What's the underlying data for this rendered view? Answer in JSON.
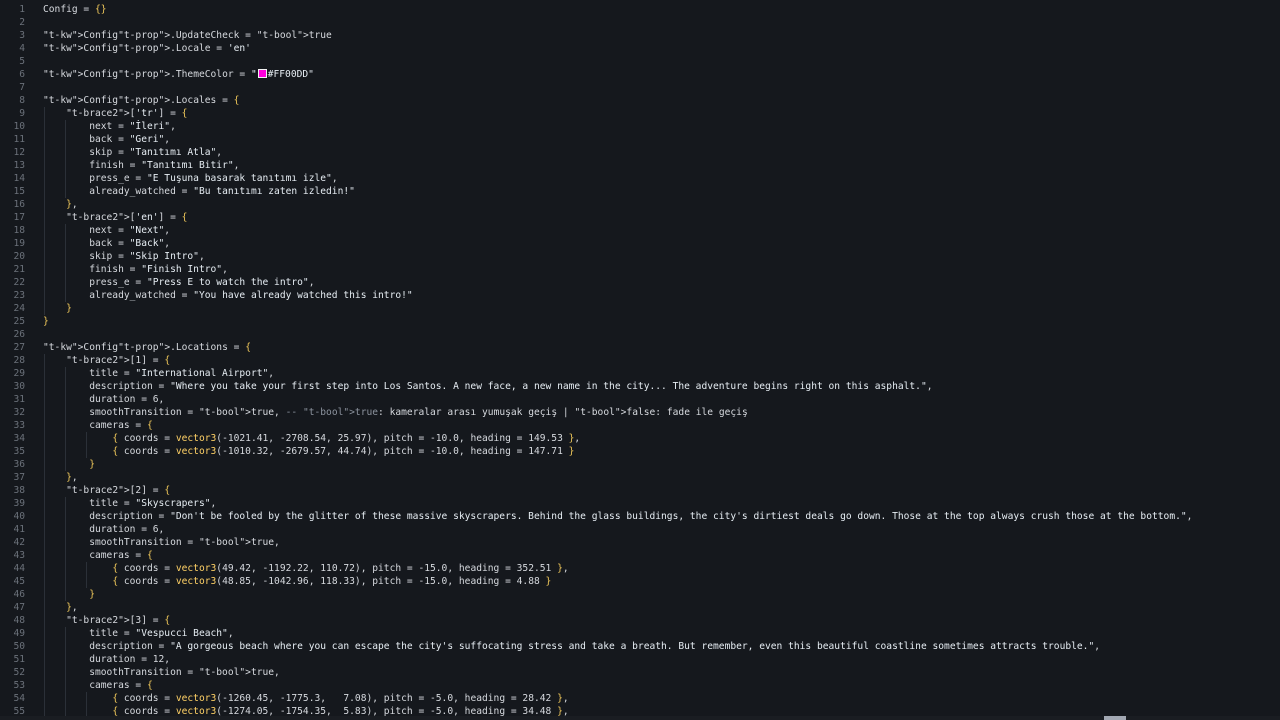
{
  "editor": {
    "lines": [
      {
        "n": "1",
        "text": "Config = {}"
      },
      {
        "n": "2",
        "text": ""
      },
      {
        "n": "3",
        "text": "Config.UpdateCheck = true"
      },
      {
        "n": "4",
        "text": "Config.Locale = 'en'"
      },
      {
        "n": "5",
        "text": ""
      },
      {
        "n": "6",
        "text": "Config.ThemeColor = \"#FF00DD\""
      },
      {
        "n": "7",
        "text": ""
      },
      {
        "n": "8",
        "text": "Config.Locales = {"
      },
      {
        "n": "9",
        "text": "    ['tr'] = {"
      },
      {
        "n": "10",
        "text": "        next = \"İleri\","
      },
      {
        "n": "11",
        "text": "        back = \"Geri\","
      },
      {
        "n": "12",
        "text": "        skip = \"Tanıtımı Atla\","
      },
      {
        "n": "13",
        "text": "        finish = \"Tanıtımı Bitir\","
      },
      {
        "n": "14",
        "text": "        press_e = \"E Tuşuna basarak tanıtımı izle\","
      },
      {
        "n": "15",
        "text": "        already_watched = \"Bu tanıtımı zaten izledin!\""
      },
      {
        "n": "16",
        "text": "    },"
      },
      {
        "n": "17",
        "text": "    ['en'] = {"
      },
      {
        "n": "18",
        "text": "        next = \"Next\","
      },
      {
        "n": "19",
        "text": "        back = \"Back\","
      },
      {
        "n": "20",
        "text": "        skip = \"Skip Intro\","
      },
      {
        "n": "21",
        "text": "        finish = \"Finish Intro\","
      },
      {
        "n": "22",
        "text": "        press_e = \"Press E to watch the intro\","
      },
      {
        "n": "23",
        "text": "        already_watched = \"You have already watched this intro!\""
      },
      {
        "n": "24",
        "text": "    }"
      },
      {
        "n": "25",
        "text": "}"
      },
      {
        "n": "26",
        "text": ""
      },
      {
        "n": "27",
        "text": "Config.Locations = {"
      },
      {
        "n": "28",
        "text": "    [1] = {"
      },
      {
        "n": "29",
        "text": "        title = \"International Airport\","
      },
      {
        "n": "30",
        "text": "        description = \"Where you take your first step into Los Santos. A new face, a new name in the city... The adventure begins right on this asphalt.\","
      },
      {
        "n": "31",
        "text": "        duration = 6,"
      },
      {
        "n": "32",
        "text": "        smoothTransition = true, -- true: kameralar arası yumuşak geçiş | false: fade ile geçiş"
      },
      {
        "n": "33",
        "text": "        cameras = {"
      },
      {
        "n": "34",
        "text": "            { coords = vector3(-1021.41, -2708.54, 25.97), pitch = -10.0, heading = 149.53 },"
      },
      {
        "n": "35",
        "text": "            { coords = vector3(-1010.32, -2679.57, 44.74), pitch = -10.0, heading = 147.71 }"
      },
      {
        "n": "36",
        "text": "        }"
      },
      {
        "n": "37",
        "text": "    },"
      },
      {
        "n": "38",
        "text": "    [2] = {"
      },
      {
        "n": "39",
        "text": "        title = \"Skyscrapers\","
      },
      {
        "n": "40",
        "text": "        description = \"Don't be fooled by the glitter of these massive skyscrapers. Behind the glass buildings, the city's dirtiest deals go down. Those at the top always crush those at the bottom.\","
      },
      {
        "n": "41",
        "text": "        duration = 6,"
      },
      {
        "n": "42",
        "text": "        smoothTransition = true,"
      },
      {
        "n": "43",
        "text": "        cameras = {"
      },
      {
        "n": "44",
        "text": "            { coords = vector3(49.42, -1192.22, 110.72), pitch = -15.0, heading = 352.51 },"
      },
      {
        "n": "45",
        "text": "            { coords = vector3(48.85, -1042.96, 118.33), pitch = -15.0, heading = 4.88 }"
      },
      {
        "n": "46",
        "text": "        }"
      },
      {
        "n": "47",
        "text": "    },"
      },
      {
        "n": "48",
        "text": "    [3] = {"
      },
      {
        "n": "49",
        "text": "        title = \"Vespucci Beach\","
      },
      {
        "n": "50",
        "text": "        description = \"A gorgeous beach where you can escape the city's suffocating stress and take a breath. But remember, even this beautiful coastline sometimes attracts trouble.\","
      },
      {
        "n": "51",
        "text": "        duration = 12,"
      },
      {
        "n": "52",
        "text": "        smoothTransition = true,"
      },
      {
        "n": "53",
        "text": "        cameras = {"
      },
      {
        "n": "54",
        "text": "            { coords = vector3(-1260.45, -1775.3,   7.08), pitch = -5.0, heading = 28.42 },"
      },
      {
        "n": "55",
        "text": "            { coords = vector3(-1274.05, -1754.35,  5.83), pitch = -5.0, heading = 34.48 },"
      }
    ],
    "theme_color": "#FF00DD"
  }
}
